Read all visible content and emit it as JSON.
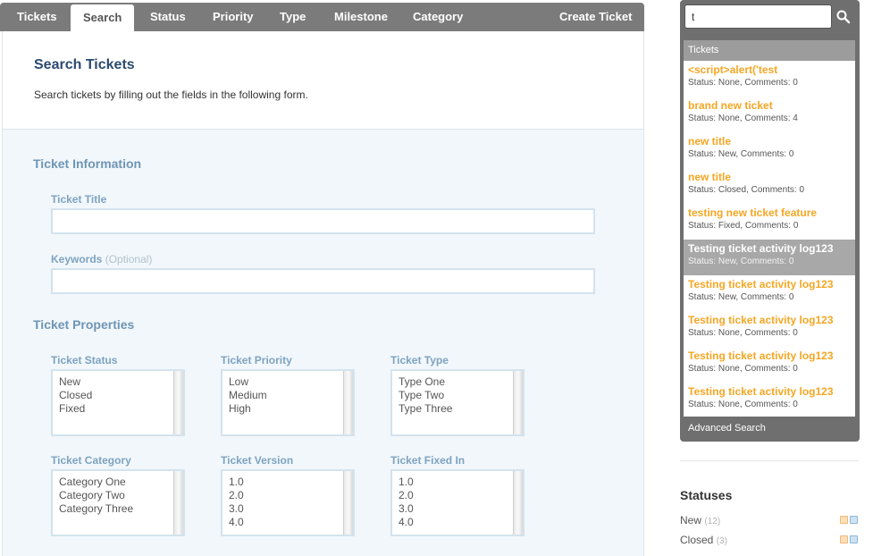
{
  "nav": {
    "items": [
      "Tickets",
      "Search",
      "Status",
      "Priority",
      "Type",
      "Milestone",
      "Category"
    ],
    "create_ticket": "Create Ticket"
  },
  "intro": {
    "title": "Search Tickets",
    "description": "Search tickets by filling out the fields in the following form."
  },
  "form": {
    "info_title": "Ticket Information",
    "ticket_title_label": "Ticket Title",
    "ticket_title_value": "",
    "keywords_label": "Keywords",
    "keywords_optional": "(Optional)",
    "keywords_value": "",
    "properties_title": "Ticket Properties",
    "lists": [
      {
        "label": "Ticket Status",
        "options": [
          "New",
          "Closed",
          "Fixed"
        ]
      },
      {
        "label": "Ticket Priority",
        "options": [
          "Low",
          "Medium",
          "High"
        ]
      },
      {
        "label": "Ticket Type",
        "options": [
          "Type One",
          "Type Two",
          "Type Three"
        ]
      },
      {
        "label": "Ticket Category",
        "options": [
          "Category One",
          "Category Two",
          "Category Three"
        ]
      },
      {
        "label": "Ticket Version",
        "options": [
          "1.0",
          "2.0",
          "3.0",
          "4.0"
        ]
      },
      {
        "label": "Ticket Fixed In",
        "options": [
          "1.0",
          "2.0",
          "3.0",
          "4.0"
        ]
      }
    ]
  },
  "search": {
    "value": "t",
    "results_header": "Tickets",
    "results": [
      {
        "title": "<script>alert('test",
        "meta": "Status: None, Comments: 0"
      },
      {
        "title": "brand new ticket",
        "meta": "Status: None, Comments: 4"
      },
      {
        "title": "new title",
        "meta": "Status: New, Comments: 0"
      },
      {
        "title": "new title",
        "meta": "Status: Closed, Comments: 0"
      },
      {
        "title": "testing new ticket feature",
        "meta": "Status: Fixed, Comments: 0"
      },
      {
        "title": "Testing ticket activity log123",
        "meta": "Status: New, Comments: 0"
      },
      {
        "title": "Testing ticket activity log123",
        "meta": "Status: New, Comments: 0"
      },
      {
        "title": "Testing ticket activity log123",
        "meta": "Status: None, Comments: 0"
      },
      {
        "title": "Testing ticket activity log123",
        "meta": "Status: None, Comments: 0"
      },
      {
        "title": "Testing ticket activity log123",
        "meta": "Status: None, Comments: 0"
      }
    ],
    "highlighted_index": 5,
    "advanced_search": "Advanced Search"
  },
  "statuses": {
    "title": "Statuses",
    "items": [
      {
        "name": "New",
        "count": "(12)"
      },
      {
        "name": "Closed",
        "count": "(3)"
      }
    ]
  },
  "colors": {
    "nav_bg": "#7b7b7b",
    "result_title": "#f5a623",
    "heading": "#2c4a70",
    "form_accent": "#6e95b5"
  },
  "icons": {
    "search": "magnifier-icon",
    "feed": "rss-icon",
    "atom": "atom-feed-icon"
  }
}
